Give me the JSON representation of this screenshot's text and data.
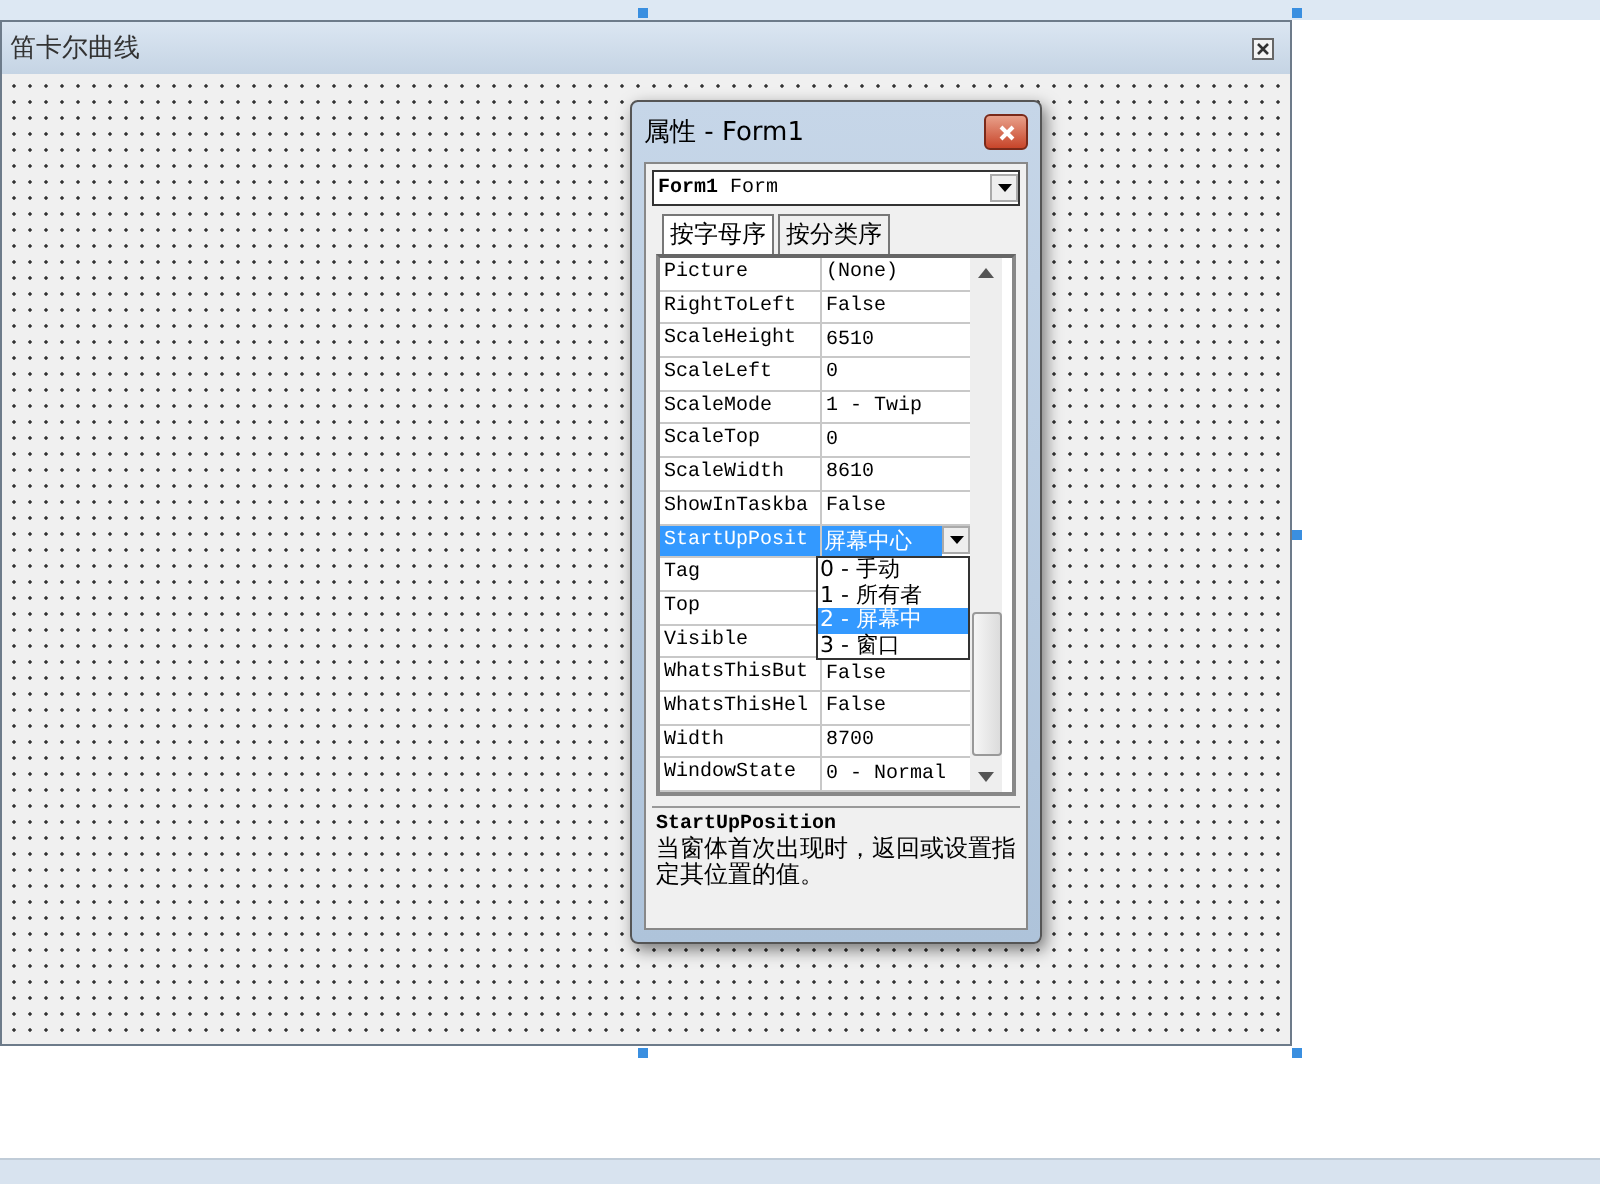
{
  "form_window": {
    "title": "笛卡尔曲线"
  },
  "properties_window": {
    "title": "属性 - Form1",
    "object_selector": "**Form1** Form",
    "tabs": [
      {
        "label": "按字母序",
        "selected": true
      },
      {
        "label": "按分类序",
        "selected": false
      }
    ],
    "properties": [
      {
        "name": "Picture",
        "value": "(None)",
        "selected": false
      },
      {
        "name": "RightToLeft",
        "value": "False",
        "selected": false
      },
      {
        "name": "ScaleHeight",
        "value": "6510",
        "selected": false
      },
      {
        "name": "ScaleLeft",
        "value": "0",
        "selected": false
      },
      {
        "name": "ScaleMode",
        "value": "1 - Twip",
        "selected": false
      },
      {
        "name": "ScaleTop",
        "value": "0",
        "selected": false
      },
      {
        "name": "ScaleWidth",
        "value": "8610",
        "selected": false
      },
      {
        "name": "ShowInTaskba",
        "value": "False",
        "selected": false
      },
      {
        "name": "StartUpPosit",
        "value": "屏幕中心",
        "selected": true
      },
      {
        "name": "Tag",
        "selected": false
      },
      {
        "name": "Top",
        "selected": false
      },
      {
        "name": "Visible",
        "selected": false
      },
      {
        "name": "WhatsThisBut",
        "value": "False",
        "selected": false
      },
      {
        "name": "WhatsThisHel",
        "value": "False",
        "selected": false
      },
      {
        "name": "Width",
        "value": "8700",
        "selected": false
      },
      {
        "name": "WindowState",
        "value": "0 - Normal",
        "selected": false
      }
    ],
    "dropdown": [
      {
        "label": "0 - 手动",
        "selected": false
      },
      {
        "label": "1 - 所有者",
        "selected": false
      },
      {
        "label": "2 - 屏幕中",
        "selected": true
      },
      {
        "label": "3 - 窗口",
        "selected": false
      }
    ],
    "description": {
      "title": "StartUpPosition",
      "text": "当窗体首次出现时，返回或设置指定其位置的值。"
    }
  }
}
